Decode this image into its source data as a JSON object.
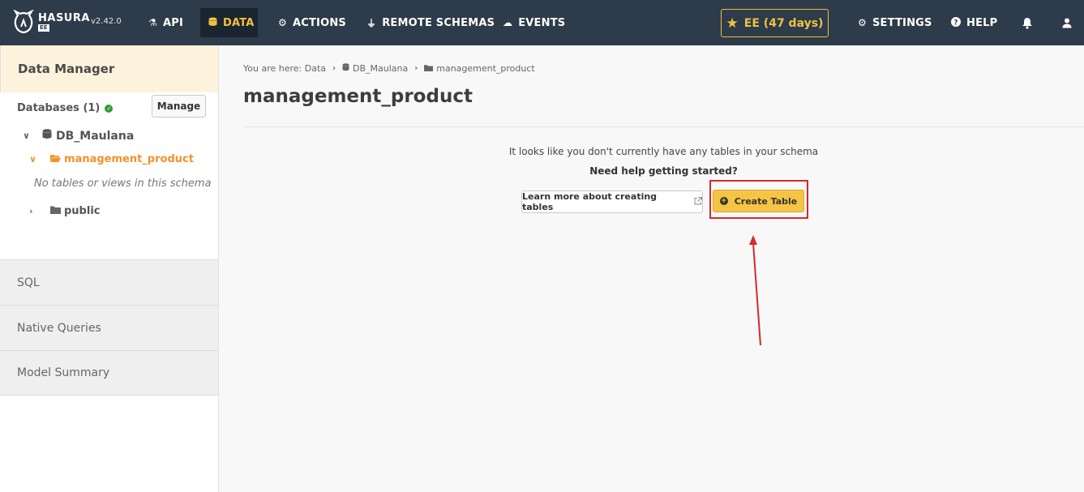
{
  "topbar": {
    "brand": "HASURA",
    "edition_tag": "EE",
    "version": "v2.42.0",
    "nav": [
      {
        "label": "API",
        "icon": "flask-icon"
      },
      {
        "label": "DATA",
        "icon": "database-icon"
      },
      {
        "label": "ACTIONS",
        "icon": "cogs-icon"
      },
      {
        "label": "REMOTE SCHEMAS",
        "icon": "plug-icon"
      },
      {
        "label": "EVENTS",
        "icon": "cloud-icon"
      }
    ],
    "ee_label": "EE (47 days)",
    "settings_label": "SETTINGS",
    "help_label": "HELP",
    "colors": {
      "bg": "#2d3b4a",
      "accent": "#f0c240"
    }
  },
  "sidebar": {
    "header": "Data Manager",
    "databases_label": "Databases (1)",
    "manage_label": "Manage",
    "database_name": "DB_Maulana",
    "active_schema": "management_product",
    "empty_note": "No tables or views in this schema",
    "other_schema": "public",
    "sections": [
      "SQL",
      "Native Queries",
      "Model Summary"
    ]
  },
  "main": {
    "breadcrumb_prefix": "You are here: Data",
    "breadcrumb_db": "DB_Maulana",
    "breadcrumb_schema": "management_product",
    "title": "management_product",
    "empty_message": "It looks like you don't currently have any tables in your schema",
    "help_message": "Need help getting started?",
    "learn_button": "Learn more about creating tables",
    "create_button": "Create Table",
    "annotation_color": "#d42a2a"
  }
}
